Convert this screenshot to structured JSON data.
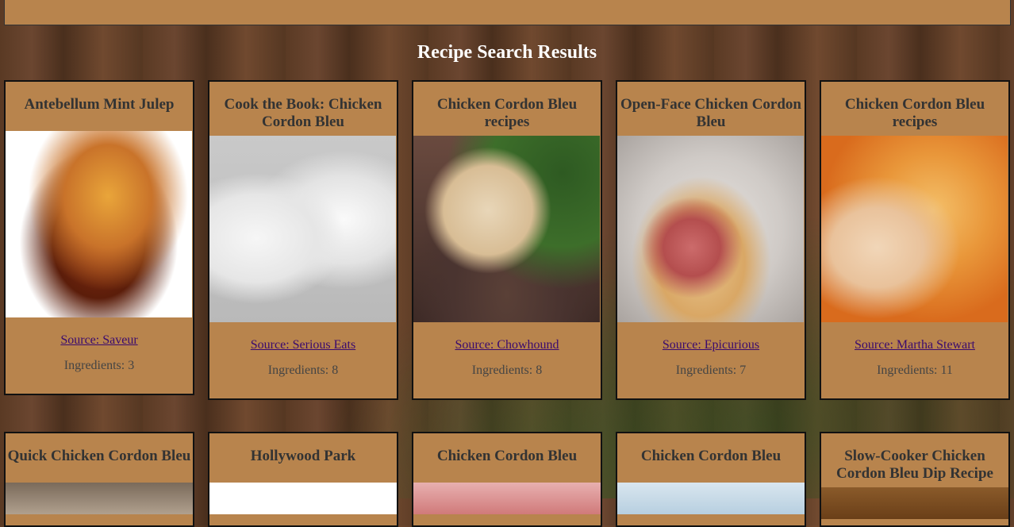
{
  "page": {
    "title": "Recipe Search Results"
  },
  "recipes": [
    {
      "title": "Antebellum Mint Julep",
      "source": "Source: Saveur",
      "ingredients": "Ingredients: 3"
    },
    {
      "title": "Cook the Book: Chicken Cordon Bleu",
      "source": "Source: Serious Eats",
      "ingredients": "Ingredients: 8"
    },
    {
      "title": "Chicken Cordon Bleu recipes",
      "source": "Source: Chowhound",
      "ingredients": "Ingredients: 8"
    },
    {
      "title": "Open-Face Chicken Cordon Bleu",
      "source": "Source: Epicurious",
      "ingredients": "Ingredients: 7"
    },
    {
      "title": "Chicken Cordon Bleu recipes",
      "source": "Source: Martha Stewart",
      "ingredients": "Ingredients: 11"
    }
  ],
  "recipes_row2": [
    {
      "title": "Quick Chicken Cordon Bleu"
    },
    {
      "title": "Hollywood Park"
    },
    {
      "title": "Chicken Cordon Bleu"
    },
    {
      "title": "Chicken Cordon Bleu"
    },
    {
      "title": "Slow-Cooker Chicken Cordon Bleu Dip Recipe"
    }
  ]
}
